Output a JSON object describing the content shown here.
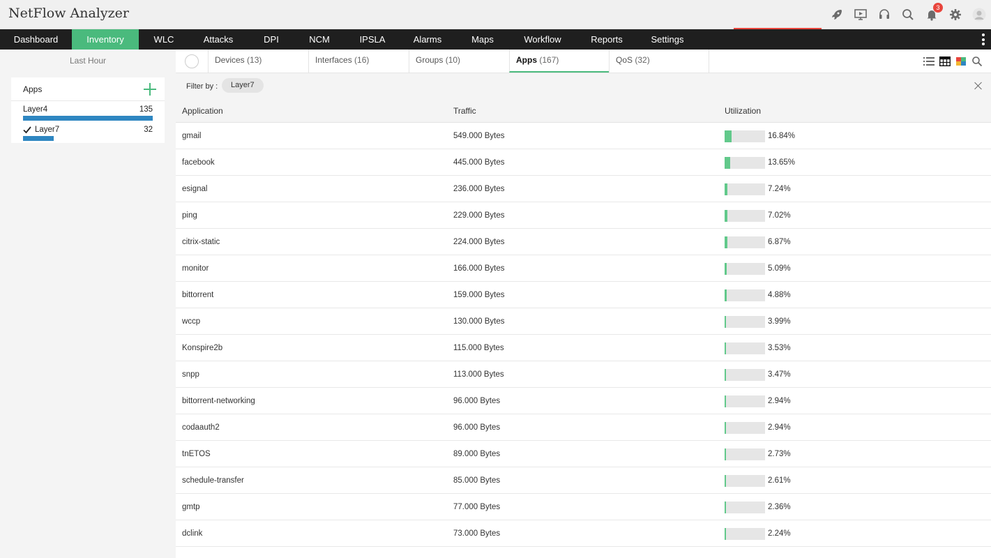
{
  "app": {
    "title": "NetFlow Analyzer"
  },
  "header": {
    "icons": [
      "rocket-icon",
      "presentation-icon",
      "headset-icon",
      "search-icon",
      "bell-icon",
      "gear-icon",
      "user-icon"
    ],
    "notification_count": "3"
  },
  "nav": {
    "items": [
      {
        "label": "Dashboard",
        "active": false
      },
      {
        "label": "Inventory",
        "active": true
      },
      {
        "label": "WLC",
        "active": false
      },
      {
        "label": "Attacks",
        "active": false
      },
      {
        "label": "DPI",
        "active": false
      },
      {
        "label": "NCM",
        "active": false
      },
      {
        "label": "IPSLA",
        "active": false
      },
      {
        "label": "Alarms",
        "active": false
      },
      {
        "label": "Maps",
        "active": false
      },
      {
        "label": "Workflow",
        "active": false
      },
      {
        "label": "Reports",
        "active": false
      },
      {
        "label": "Settings",
        "active": false
      }
    ]
  },
  "sidebar": {
    "period": "Last Hour",
    "apps_title": "Apps",
    "layers": [
      {
        "name": "Layer4",
        "count": "135",
        "share": 1.0,
        "selected": false
      },
      {
        "name": "Layer7",
        "count": "32",
        "share": 0.237,
        "selected": true
      }
    ]
  },
  "tabs": [
    {
      "label": "Devices",
      "count": "(13)",
      "active": false
    },
    {
      "label": "Interfaces",
      "count": "(16)",
      "active": false
    },
    {
      "label": "Groups",
      "count": "(10)",
      "active": false
    },
    {
      "label": "Apps",
      "count": "(167)",
      "active": true
    },
    {
      "label": "QoS",
      "count": "(32)",
      "active": false
    }
  ],
  "filter": {
    "label": "Filter by :",
    "chip": "Layer7"
  },
  "table": {
    "columns": {
      "application": "Application",
      "traffic": "Traffic",
      "utilization": "Utilization"
    },
    "rows": [
      {
        "application": "gmail",
        "traffic": "549.000 Bytes",
        "utilization": "16.84%",
        "pct": 16.84
      },
      {
        "application": "facebook",
        "traffic": "445.000 Bytes",
        "utilization": "13.65%",
        "pct": 13.65
      },
      {
        "application": "esignal",
        "traffic": "236.000 Bytes",
        "utilization": "7.24%",
        "pct": 7.24
      },
      {
        "application": "ping",
        "traffic": "229.000 Bytes",
        "utilization": "7.02%",
        "pct": 7.02
      },
      {
        "application": "citrix-static",
        "traffic": "224.000 Bytes",
        "utilization": "6.87%",
        "pct": 6.87
      },
      {
        "application": "monitor",
        "traffic": "166.000 Bytes",
        "utilization": "5.09%",
        "pct": 5.09
      },
      {
        "application": "bittorrent",
        "traffic": "159.000 Bytes",
        "utilization": "4.88%",
        "pct": 4.88
      },
      {
        "application": "wccp",
        "traffic": "130.000 Bytes",
        "utilization": "3.99%",
        "pct": 3.99
      },
      {
        "application": "Konspire2b",
        "traffic": "115.000 Bytes",
        "utilization": "3.53%",
        "pct": 3.53
      },
      {
        "application": "snpp",
        "traffic": "113.000 Bytes",
        "utilization": "3.47%",
        "pct": 3.47
      },
      {
        "application": "bittorrent-networking",
        "traffic": "96.000 Bytes",
        "utilization": "2.94%",
        "pct": 2.94
      },
      {
        "application": "codaauth2",
        "traffic": "96.000 Bytes",
        "utilization": "2.94%",
        "pct": 2.94
      },
      {
        "application": "tnETOS",
        "traffic": "89.000 Bytes",
        "utilization": "2.73%",
        "pct": 2.73
      },
      {
        "application": "schedule-transfer",
        "traffic": "85.000 Bytes",
        "utilization": "2.61%",
        "pct": 2.61
      },
      {
        "application": "gmtp",
        "traffic": "77.000 Bytes",
        "utilization": "2.36%",
        "pct": 2.36
      },
      {
        "application": "dclink",
        "traffic": "73.000 Bytes",
        "utilization": "2.24%",
        "pct": 2.24
      }
    ]
  },
  "colors": {
    "accent": "#4aba7d",
    "layer_bar": "#2e86c1",
    "util_fill": "#62c98b",
    "badge": "#e8453c"
  }
}
